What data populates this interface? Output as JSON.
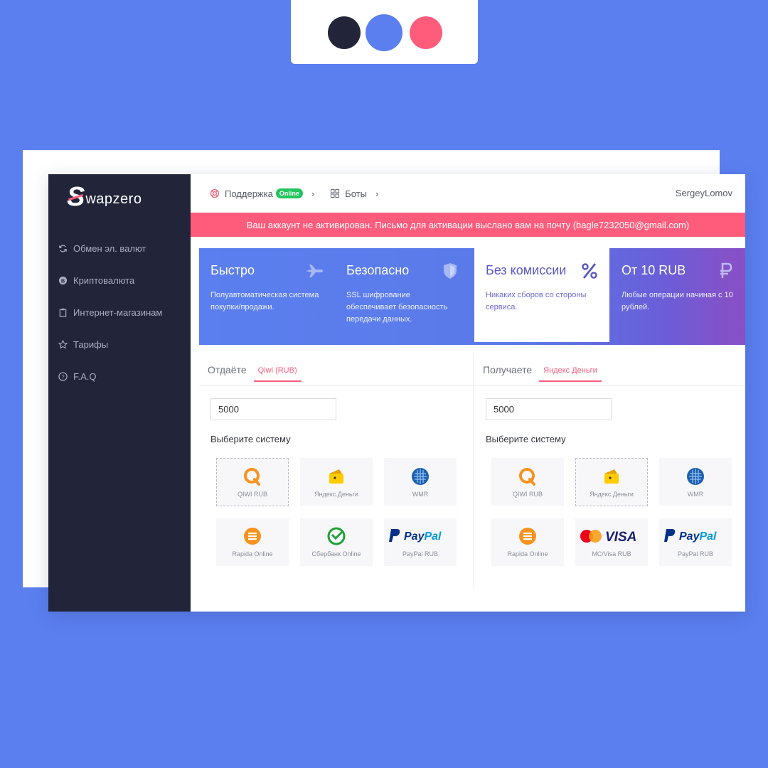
{
  "colors": {
    "dot1": "#22253a",
    "dot2": "#5b7fef",
    "dot3": "#ff5c7c",
    "accent": "#ff5c7c",
    "brand": "#5b7fef",
    "sidebar": "#22253a",
    "online": "#22c55e"
  },
  "logo": {
    "s": "S",
    "rest": "wapzero"
  },
  "sidebar": {
    "items": [
      {
        "label": "Обмен эл. валют",
        "icon": "refresh-icon"
      },
      {
        "label": "Криптовалюта",
        "icon": "coin-icon"
      },
      {
        "label": "Интернет-магазинам",
        "icon": "clipboard-icon"
      },
      {
        "label": "Тарифы",
        "icon": "star-icon"
      },
      {
        "label": "F.A.Q",
        "icon": "help-icon"
      }
    ]
  },
  "topbar": {
    "support": "Поддержка",
    "online": "Online",
    "bots": "Боты",
    "chevron": "›",
    "user": "SergeyLomov"
  },
  "alert": "Ваш аккаунт не активирован. Письмо для активации выслано вам на почту (bagle7232050@gmail.com)",
  "features": [
    {
      "title": "Быстро",
      "desc": "Полуавтоматическая система покупки/продажи.",
      "icon": "plane-icon"
    },
    {
      "title": "Безопасно",
      "desc": "SSL шифрование обеспечивает безопасность передачи данных.",
      "icon": "shield-icon"
    },
    {
      "title": "Без комиссии",
      "desc": "Никаких сборов со стороны сервиса.",
      "icon": "percent-icon"
    },
    {
      "title": "От 10 RUB",
      "desc": "Любые операции начиная с 10 рублей.",
      "icon": "ruble-icon"
    }
  ],
  "give": {
    "label": "Отдаёте",
    "tab": "Qiwi (RUB)",
    "amount": "5000",
    "choose": "Выберите систему",
    "tiles": [
      "QIWI RUB",
      "Яндекс.Деньги",
      "WMR",
      "Rapida Online",
      "Сбербанк Online",
      "PayPal RUB"
    ]
  },
  "get": {
    "label": "Получаете",
    "tab": "Яндекс Деньги",
    "amount": "5000",
    "choose": "Выберите систему",
    "tiles": [
      "QIWI RUB",
      "Яндекс.Деньги",
      "WMR",
      "Rapida Online",
      "MC/Visa RUB",
      "PayPal RUB"
    ]
  },
  "logos": {
    "paypal_text": "PayPal",
    "visa_text": "VISA"
  }
}
